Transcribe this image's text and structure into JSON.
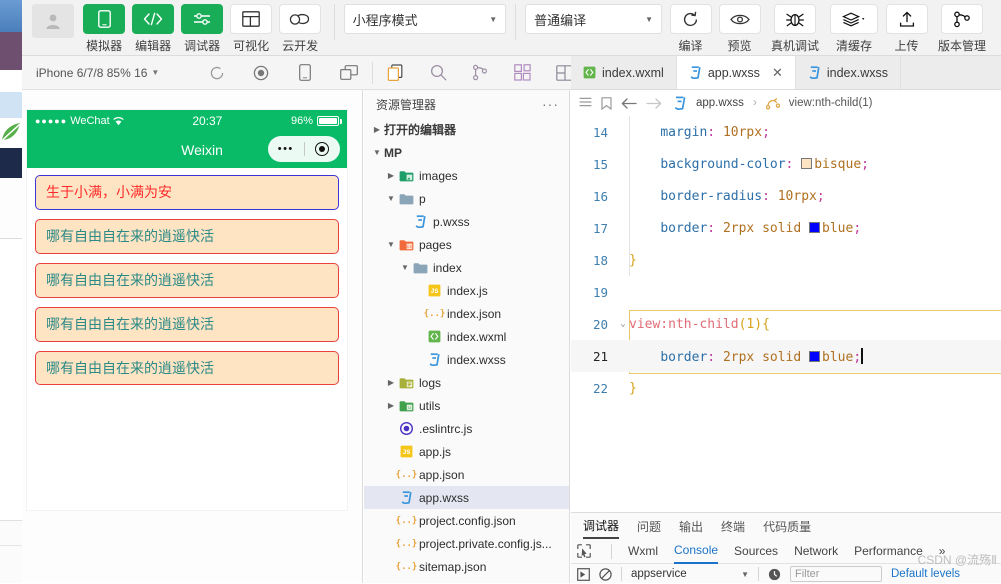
{
  "toolbar": {
    "avatar_icon": "user-avatar-icon",
    "items": [
      {
        "label": "模拟器",
        "icon": "phone-simulator-icon",
        "active": true
      },
      {
        "label": "编辑器",
        "icon": "code-editor-icon",
        "active": true
      },
      {
        "label": "调试器",
        "icon": "debugger-sliders-icon",
        "active": true
      },
      {
        "label": "可视化",
        "icon": "layout-visual-icon",
        "active": false
      },
      {
        "label": "云开发",
        "icon": "cloud-icon",
        "active": false
      }
    ],
    "mode_select": {
      "value": "小程序模式",
      "caret": "▼"
    },
    "compile_select": {
      "value": "普通编译",
      "caret": "▼"
    },
    "actions": [
      {
        "label": "编译",
        "icon": "refresh-compile-icon"
      },
      {
        "label": "预览",
        "icon": "eye-preview-icon"
      },
      {
        "label": "真机调试",
        "icon": "bug-device-debug-icon"
      },
      {
        "label": "清缓存",
        "icon": "layers-clear-cache-icon",
        "caret": "▾"
      }
    ],
    "right_actions": [
      {
        "label": "上传",
        "icon": "upload-icon"
      },
      {
        "label": "版本管理",
        "icon": "branch-version-icon"
      }
    ]
  },
  "simbar": {
    "device": "iPhone 6/7/8 85% 16",
    "device_caret": "▼",
    "icons_left": [
      "refresh-circle-icon",
      "record-stop-icon",
      "phone-outline-icon",
      "multi-window-icon"
    ],
    "icons_right": [
      "copy-files-icon",
      "search-icon",
      "source-control-icon",
      "extensions-icon",
      "split-layout-icon",
      "docker-icon"
    ]
  },
  "simulator": {
    "status": {
      "carrier_dots": "●●●●●",
      "carrier": "WeChat",
      "wifi": "wifi-icon",
      "time": "20:37",
      "battery_pct": "96%"
    },
    "nav": {
      "title": "Weixin",
      "capsule_dots": "•••",
      "capsule_target": "target-icon"
    },
    "views": [
      {
        "text": "生于小满，小满为安",
        "style": "first"
      },
      {
        "text": "哪有自由自在来的逍遥快活",
        "style": "rest"
      },
      {
        "text": "哪有自由自在来的逍遥快活",
        "style": "rest"
      },
      {
        "text": "哪有自由自在来的逍遥快活",
        "style": "rest"
      },
      {
        "text": "哪有自由自在来的逍遥快活",
        "style": "rest"
      }
    ],
    "colors": {
      "header": "#09bb67",
      "view_bg": "#ffe4c4",
      "first_border": "#3b35d8",
      "first_text": "#fe2b2b",
      "rest_border": "#e94040",
      "rest_text": "#2a8a86"
    }
  },
  "explorer": {
    "title": "资源管理器",
    "more": "···",
    "open_editors": "打开的编辑器",
    "root": "MP",
    "tree": [
      {
        "label": "images",
        "type": "folder-img",
        "depth": 1,
        "arrow": "closed"
      },
      {
        "label": "p",
        "type": "folder",
        "depth": 1,
        "arrow": "open"
      },
      {
        "label": "p.wxss",
        "type": "wxss",
        "depth": 2,
        "arrow": "none"
      },
      {
        "label": "pages",
        "type": "folder-pages",
        "depth": 1,
        "arrow": "open"
      },
      {
        "label": "index",
        "type": "folder",
        "depth": 2,
        "arrow": "open"
      },
      {
        "label": "index.js",
        "type": "js",
        "depth": 3,
        "arrow": "none"
      },
      {
        "label": "index.json",
        "type": "json",
        "depth": 3,
        "arrow": "none"
      },
      {
        "label": "index.wxml",
        "type": "wxml",
        "depth": 3,
        "arrow": "none"
      },
      {
        "label": "index.wxss",
        "type": "wxss",
        "depth": 3,
        "arrow": "none"
      },
      {
        "label": "logs",
        "type": "folder-logs",
        "depth": 1,
        "arrow": "closed"
      },
      {
        "label": "utils",
        "type": "folder-utils",
        "depth": 1,
        "arrow": "closed"
      },
      {
        "label": ".eslintrc.js",
        "type": "eslint",
        "depth": 1,
        "arrow": "none"
      },
      {
        "label": "app.js",
        "type": "js",
        "depth": 1,
        "arrow": "none"
      },
      {
        "label": "app.json",
        "type": "json",
        "depth": 1,
        "arrow": "none"
      },
      {
        "label": "app.wxss",
        "type": "wxss",
        "depth": 1,
        "arrow": "none",
        "selected": true
      },
      {
        "label": "project.config.json",
        "type": "json",
        "depth": 1,
        "arrow": "none"
      },
      {
        "label": "project.private.config.js...",
        "type": "json",
        "depth": 1,
        "arrow": "none"
      },
      {
        "label": "sitemap.json",
        "type": "json",
        "depth": 1,
        "arrow": "none"
      }
    ]
  },
  "editor": {
    "tabs": [
      {
        "label": "index.wxml",
        "type": "wxml",
        "active": false,
        "closable": false
      },
      {
        "label": "app.wxss",
        "type": "wxss",
        "active": true,
        "closable": true,
        "close": "✕"
      },
      {
        "label": "index.wxss",
        "type": "wxss",
        "active": false,
        "closable": false
      }
    ],
    "breadcrumb": {
      "icons": [
        "outline-list-icon",
        "bookmark-icon",
        "back-arrow-icon",
        "forward-arrow-icon"
      ],
      "file": "app.wxss",
      "separator": "›",
      "symbol": "view:nth-child(1)",
      "symbol_icon": "css-selector-icon"
    },
    "code_lines": [
      {
        "num": "14",
        "tokens": [
          {
            "t": "    ",
            "c": ""
          },
          {
            "t": "margin",
            "c": "k-prop"
          },
          {
            "t": ":",
            "c": "k-punc"
          },
          {
            "t": " ",
            "c": ""
          },
          {
            "t": "10rpx",
            "c": "k-val"
          },
          {
            "t": ";",
            "c": "k-punc"
          }
        ],
        "fold": "",
        "indent": true
      },
      {
        "num": "15",
        "tokens": [
          {
            "t": "    ",
            "c": ""
          },
          {
            "t": "background-color",
            "c": "k-prop"
          },
          {
            "t": ":",
            "c": "k-punc"
          },
          {
            "t": " ",
            "c": ""
          },
          {
            "t": "@swatch:#ffe4c4",
            "c": ""
          },
          {
            "t": "bisque",
            "c": "k-val"
          },
          {
            "t": ";",
            "c": "k-punc"
          }
        ],
        "fold": "",
        "indent": true
      },
      {
        "num": "16",
        "tokens": [
          {
            "t": "    ",
            "c": ""
          },
          {
            "t": "border-radius",
            "c": "k-prop"
          },
          {
            "t": ":",
            "c": "k-punc"
          },
          {
            "t": " ",
            "c": ""
          },
          {
            "t": "10rpx",
            "c": "k-val"
          },
          {
            "t": ";",
            "c": "k-punc"
          }
        ],
        "fold": "",
        "indent": true
      },
      {
        "num": "17",
        "tokens": [
          {
            "t": "    ",
            "c": ""
          },
          {
            "t": "border",
            "c": "k-prop"
          },
          {
            "t": ":",
            "c": "k-punc"
          },
          {
            "t": " ",
            "c": ""
          },
          {
            "t": "2rpx solid ",
            "c": "k-val"
          },
          {
            "t": "@swatch:#0000ff",
            "c": ""
          },
          {
            "t": "blue",
            "c": "k-val"
          },
          {
            "t": ";",
            "c": "k-punc"
          }
        ],
        "fold": "",
        "indent": true
      },
      {
        "num": "18",
        "tokens": [
          {
            "t": "}",
            "c": "k-brace"
          }
        ],
        "fold": "",
        "indent": false
      },
      {
        "num": "19",
        "tokens": [],
        "fold": "",
        "indent": false
      },
      {
        "num": "20",
        "tokens": [
          {
            "t": "view:nth-child",
            "c": "k-sel"
          },
          {
            "t": "(1)",
            "c": "k-paren"
          },
          {
            "t": "{",
            "c": "k-brace"
          }
        ],
        "fold": "⌄",
        "indent": false
      },
      {
        "num": "21",
        "tokens": [
          {
            "t": "    ",
            "c": ""
          },
          {
            "t": "border",
            "c": "k-prop"
          },
          {
            "t": ":",
            "c": "k-punc"
          },
          {
            "t": " ",
            "c": ""
          },
          {
            "t": "2rpx solid ",
            "c": "k-val"
          },
          {
            "t": "@swatch:#0000ff",
            "c": ""
          },
          {
            "t": "blue",
            "c": "k-val"
          },
          {
            "t": ";",
            "c": "k-punc"
          },
          {
            "t": "@caret",
            "c": ""
          }
        ],
        "fold": "",
        "indent": true,
        "highlight": true
      },
      {
        "num": "22",
        "tokens": [
          {
            "t": "}",
            "c": "k-brace"
          }
        ],
        "fold": "",
        "indent": false
      }
    ]
  },
  "debug": {
    "panel_tabs": [
      {
        "label": "调试器",
        "active": true
      },
      {
        "label": "问题",
        "active": false
      },
      {
        "label": "输出",
        "active": false
      },
      {
        "label": "终端",
        "active": false
      },
      {
        "label": "代码质量",
        "active": false
      }
    ],
    "devtool_tabs": [
      {
        "label": "Wxml",
        "active": false
      },
      {
        "label": "Console",
        "active": true
      },
      {
        "label": "Sources",
        "active": false
      },
      {
        "label": "Network",
        "active": false
      },
      {
        "label": "Performance",
        "active": false
      }
    ],
    "inspect_icon": "inspect-element-icon",
    "overflow": "»",
    "console": {
      "play_icon": "step-icon",
      "clear_icon": "clear-console-icon",
      "context": "appservice",
      "context_caret": "▼",
      "settings_icon": "filter-settings-icon",
      "filter_placeholder": "Filter",
      "levels": "Default levels"
    },
    "watermark": "CSDN @流殇Ⅱ"
  }
}
